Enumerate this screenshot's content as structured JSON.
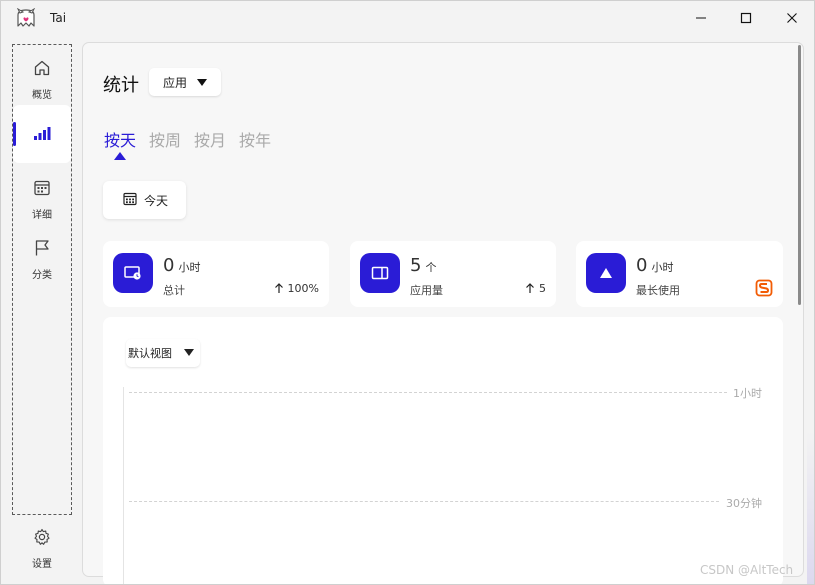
{
  "window": {
    "title": "Tai"
  },
  "sidebar": {
    "items": [
      {
        "label": "概览",
        "icon": "home-icon"
      },
      {
        "label": "",
        "icon": "signal-bars-icon",
        "active": true
      },
      {
        "label": "详细",
        "icon": "calendar-icon"
      },
      {
        "label": "分类",
        "icon": "flag-icon"
      }
    ],
    "settings_label": "设置"
  },
  "main": {
    "title": "统计",
    "type_select": {
      "selected": "应用"
    },
    "tabs": [
      {
        "label": "按天",
        "active": true
      },
      {
        "label": "按周"
      },
      {
        "label": "按月"
      },
      {
        "label": "按年"
      }
    ],
    "date_button": "今天",
    "cards": [
      {
        "value": "0",
        "unit": "小时",
        "caption": "总计",
        "delta": "100%"
      },
      {
        "value": "5",
        "unit": "个",
        "caption": "应用量",
        "delta": "5"
      },
      {
        "value": "0",
        "unit": "小时",
        "caption": "最长使用",
        "delta": ""
      }
    ],
    "chart": {
      "view_select": "默认视图",
      "grid_labels": [
        "1小时",
        "30分钟"
      ]
    }
  },
  "watermark": "CSDN @AltTech",
  "colors": {
    "accent": "#2a1cd6",
    "background": "#f3f3f3",
    "card": "#ffffff",
    "sougou_orange": "#f25c05"
  }
}
